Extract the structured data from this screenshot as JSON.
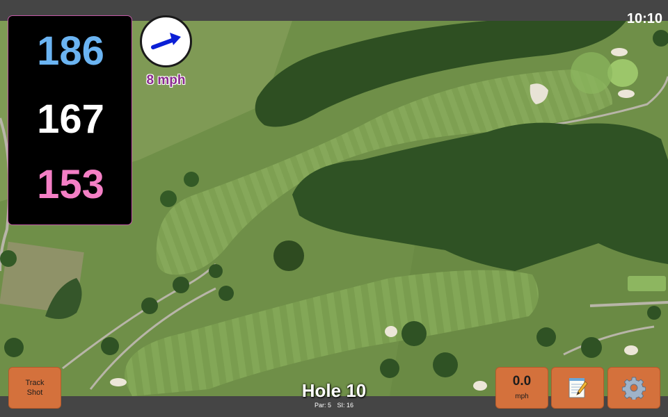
{
  "status": {
    "time": "10:10"
  },
  "distances": {
    "back": "186",
    "middle": "167",
    "front": "153"
  },
  "wind": {
    "speed": "8 mph",
    "direction_icon": "wind-arrow-icon"
  },
  "hole": {
    "title": "Hole 10",
    "par": "Par: 5",
    "stroke_index": "SI: 16"
  },
  "buttons": {
    "track_shot": [
      "Track",
      "Shot"
    ],
    "speed_value": "0.0",
    "speed_unit": "mph",
    "notes_icon": "notepad-icon",
    "settings_icon": "gear-icon"
  },
  "colors": {
    "back": "#6bb4f2",
    "middle": "#ffffff",
    "front": "#f47fc5",
    "button": "#d4713c",
    "wind_text": "#8a2a8f"
  }
}
